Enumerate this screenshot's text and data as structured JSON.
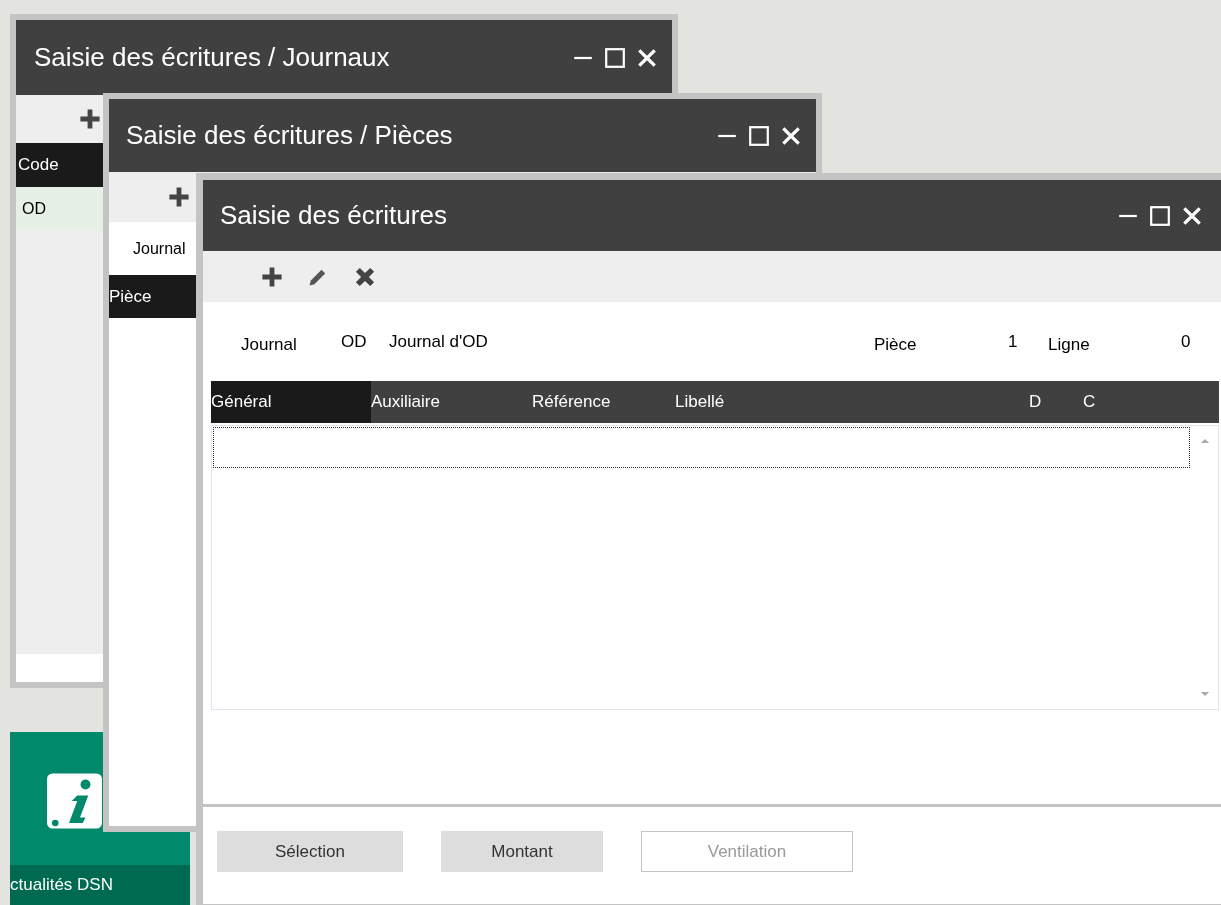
{
  "windows": [
    {
      "title": "Saisie des écritures / Journaux",
      "columns": [
        "Code"
      ],
      "rows": [
        "OD"
      ]
    },
    {
      "title": "Saisie des écritures  / Pièces",
      "field_label": "Journal",
      "columns": [
        "Pièce"
      ]
    },
    {
      "title": "Saisie des écritures",
      "header": {
        "journal_label": "Journal",
        "journal_code": "OD",
        "journal_name": "Journal d'OD",
        "piece_label": "Pièce",
        "piece_value": "1",
        "ligne_label": "Ligne",
        "ligne_value": "0"
      },
      "columns": [
        {
          "label": "Général",
          "selected": true
        },
        {
          "label": "Auxiliaire",
          "selected": false
        },
        {
          "label": "Référence",
          "selected": false
        },
        {
          "label": "Libellé",
          "selected": false
        },
        {
          "label": "D",
          "selected": false
        },
        {
          "label": "C",
          "selected": false
        }
      ],
      "buttons": [
        {
          "label": "Sélection",
          "disabled": false
        },
        {
          "label": "Montant",
          "disabled": false
        },
        {
          "label": "Ventilation",
          "disabled": true
        }
      ]
    }
  ],
  "side_panel": {
    "label": "ctualités DSN"
  }
}
